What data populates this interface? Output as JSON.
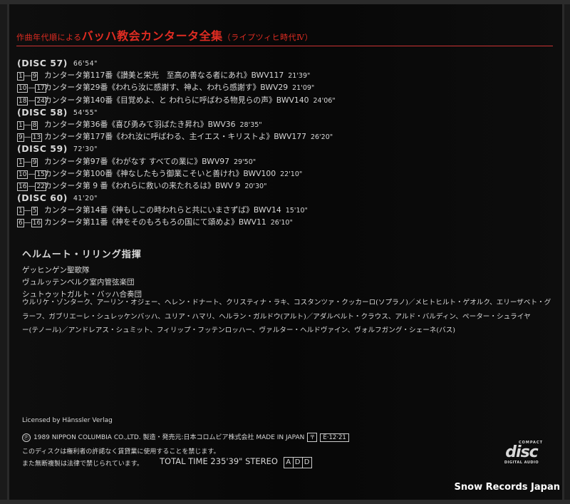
{
  "header": {
    "prefix": "作曲年代順による",
    "main": "バッハ教会カンタータ全集",
    "suffix": "（ライプツィヒ時代Ⅳ）"
  },
  "discs": [
    {
      "label": "(DISC 57)",
      "time": "66'54\"",
      "tracks": [
        {
          "num": [
            "1",
            "9"
          ],
          "cantata": "カンタータ第117番《讃美と栄光　至高の善なる者にあれ》BWV117",
          "time": "21'39\""
        },
        {
          "num": [
            "10",
            "17"
          ],
          "cantata": "カンタータ第29番《われら汝に感謝す、神よ、われら感謝す》BWV29",
          "time": "21'09\""
        },
        {
          "num": [
            "18",
            "24"
          ],
          "cantata": "カンタータ第140番《目覚めよ、と われらに呼ばわる物見らの声》BWV140",
          "time": "24'06\""
        }
      ]
    },
    {
      "label": "(DISC 58)",
      "time": "54'55\"",
      "tracks": [
        {
          "num": [
            "1",
            "8"
          ],
          "cantata": "カンタータ第36番《喜び勇みて羽ばたき昇れ》BWV36",
          "time": "28'35\""
        },
        {
          "num": [
            "9",
            "13"
          ],
          "cantata": "カンタータ第177番《われ汝に呼ばわる、主イエス・キリストよ》BWV177",
          "time": "26'20\""
        }
      ]
    },
    {
      "label": "(DISC 59)",
      "time": "72'30\"",
      "tracks": [
        {
          "num": [
            "1",
            "9"
          ],
          "cantata": "カンタータ第97番《わがなす すべての業に》BWV97",
          "time": "29'50\""
        },
        {
          "num": [
            "10",
            "15"
          ],
          "cantata": "カンタータ第100番《神なしたもう御業こそいと善けれ》BWV100",
          "time": "22'10\""
        },
        {
          "num": [
            "16",
            "22"
          ],
          "cantata": "カンタータ第 9 番《われらに救いの来たれるは》BWV 9",
          "time": "20'30\""
        }
      ]
    },
    {
      "label": "(DISC 60)",
      "time": "41'20\"",
      "tracks": [
        {
          "num": [
            "1",
            "5"
          ],
          "cantata": "カンタータ第14番《神もしこの時われらと共にいまさずば》BWV14",
          "time": "15'10\""
        },
        {
          "num": [
            "6",
            "16"
          ],
          "cantata": "カンタータ第11番《神をそのもろもろの国にて頌めよ》BWV11",
          "time": "26'10\""
        }
      ]
    }
  ],
  "performers": {
    "conductor": "ヘルムート・リリング指揮",
    "ensembles": [
      "ゲッヒンゲン聖歌隊",
      "ヴュルッテンベルク室内管弦楽団",
      "シュトゥットガルト・バッハ合奏団"
    ]
  },
  "soloists": [
    "ウルリケ・ゾンターク、アーリン・オジェー、ヘレン・ドナート、クリスティナ・ラキ、コスタンツァ・クッカーロ(ソプラノ)／メヒトヒルト・ゲオルク、エリーザベト・グ",
    "ラーフ、ガブリエーレ・シュレッケンバッハ、ユリア・ハマリ、ヘルラン・ガルドウ(アルト)／アダルベルト・クラウス、アルド・バルディン、ペーター・シュライヤ",
    "ー(テノール)／アンドレアス・シュミット、フィリップ・フッテンロッハー、ヴァルター・ヘルドヴァイン、ヴォルフガング・シェーネ(バス)"
  ],
  "footer": {
    "license": "Licensed by Hänssler Verlag",
    "p_mark": "Ⓟ",
    "copyright": "1989 NIPPON COLUMBIA CO.,LTD.  製造・発売元:日本コロムビア株式会社  MADE IN JAPAN",
    "mark": "〒",
    "code": "E·12·21",
    "note1": "このディスクは権利者の許諾なく賃貸業に使用することを禁じます。",
    "note2": "また無断複製は法律で禁じられています。",
    "total": "TOTAL TIME 235'39\"  STEREO",
    "add": [
      "A",
      "D",
      "D"
    ]
  },
  "cd_logo": {
    "compact": "COMPACT",
    "disc": "disc",
    "digital": "DIGITAL AUDIO"
  },
  "watermark": "Snow Records Japan"
}
